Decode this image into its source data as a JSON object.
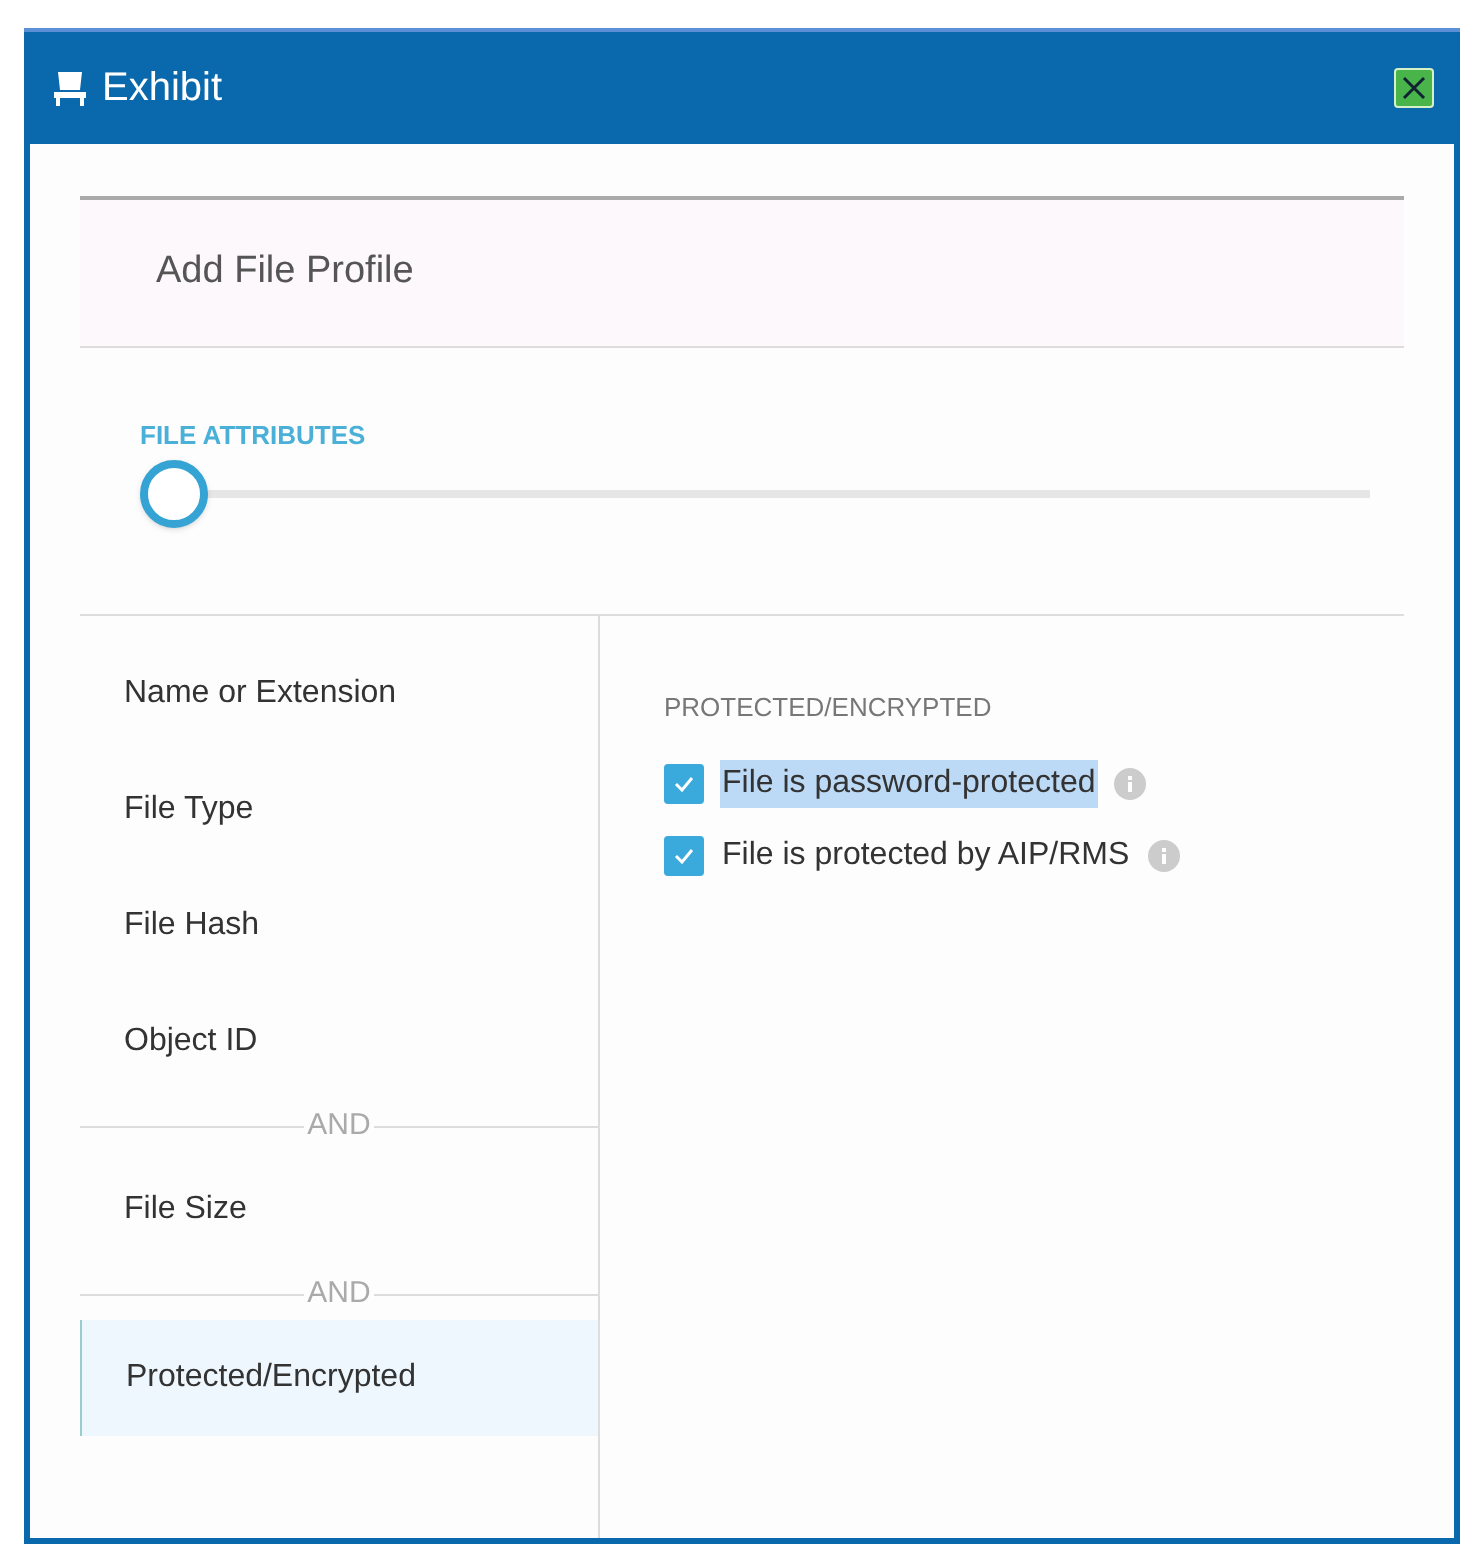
{
  "window": {
    "title": "Exhibit"
  },
  "header": {
    "title": "Add File Profile"
  },
  "slider": {
    "label": "FILE ATTRIBUTES",
    "level": 0
  },
  "sidebar": {
    "items": [
      {
        "kind": "item",
        "label": "Name or Extension",
        "selected": false
      },
      {
        "kind": "item",
        "label": "File Type",
        "selected": false
      },
      {
        "kind": "item",
        "label": "File Hash",
        "selected": false
      },
      {
        "kind": "item",
        "label": "Object ID",
        "selected": false
      },
      {
        "kind": "separator",
        "label": "AND"
      },
      {
        "kind": "item",
        "label": "File Size",
        "selected": false
      },
      {
        "kind": "separator",
        "label": "AND"
      },
      {
        "kind": "item",
        "label": "Protected/Encrypted",
        "selected": true
      }
    ]
  },
  "panel": {
    "title": "PROTECTED/ENCRYPTED",
    "options": [
      {
        "label": "File is password-protected",
        "checked": true,
        "selected": true
      },
      {
        "label": "File is protected by AIP/RMS",
        "checked": true,
        "selected": false
      }
    ]
  }
}
